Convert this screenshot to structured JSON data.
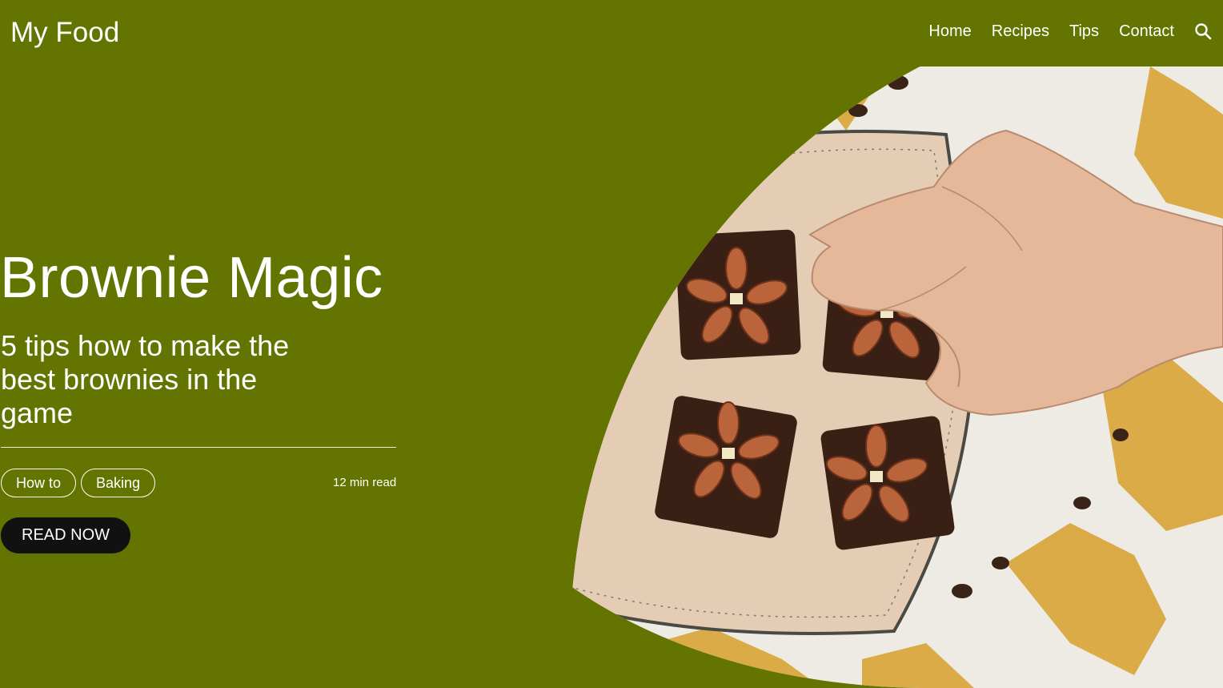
{
  "header": {
    "logo": "My Food",
    "nav": [
      {
        "label": "Home"
      },
      {
        "label": "Recipes"
      },
      {
        "label": "Tips"
      },
      {
        "label": "Contact"
      }
    ],
    "search_icon": "search-icon"
  },
  "hero": {
    "title": "Brownie Magic",
    "subtitle": "5 tips how to make the best brownies in the game",
    "tags": [
      "How to",
      "Baking"
    ],
    "read_time": "12 min read",
    "cta_label": "READ NOW"
  },
  "colors": {
    "background": "#637400",
    "button": "#111111",
    "text": "#ffffff"
  }
}
